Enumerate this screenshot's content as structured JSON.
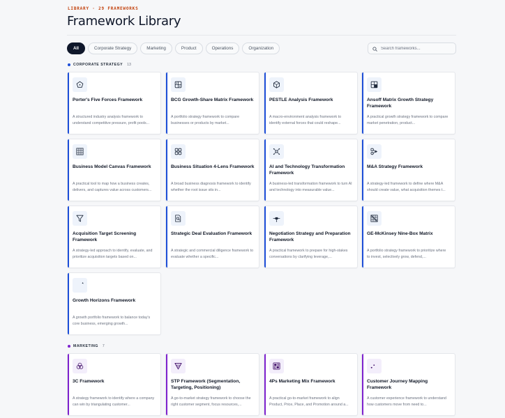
{
  "header": {
    "eyebrow": "LIBRARY · 29 FRAMEWORKS",
    "title": "Framework Library"
  },
  "filters": [
    "All",
    "Corporate Strategy",
    "Marketing",
    "Product",
    "Operations",
    "Organization"
  ],
  "active_filter": "All",
  "search": {
    "placeholder": "Search frameworks..."
  },
  "colors": {
    "eyebrow": "#c2410c",
    "corporate_accent": "#1d4ed8",
    "corporate_icon_bg": "#eef3fb",
    "marketing_accent": "#7e22ce",
    "marketing_icon_bg": "#f3eefb"
  },
  "sections": [
    {
      "name": "CORPORATE STRATEGY",
      "count": "13",
      "cards": [
        {
          "icon": "pentagon-icon",
          "title": "Porter's Five Forces Framework",
          "desc": "A structured industry analysis framework to understand competitive pressure, profit pools..."
        },
        {
          "icon": "grid-2x2-icon",
          "title": "BCG Growth-Share Matrix Framework",
          "desc": "A portfolio strategy framework to compare businesses or products by market..."
        },
        {
          "icon": "cube-icon",
          "title": "PESTLE Analysis Framework",
          "desc": "A macro-environment analysis framework to identify external forces that could reshape..."
        },
        {
          "icon": "matrix-arrow-icon",
          "title": "Ansoff Matrix Growth Strategy Framework",
          "desc": "A practical growth strategy framework to compare market penetration, product..."
        },
        {
          "icon": "canvas-grid-icon",
          "title": "Business Model Canvas Framework",
          "desc": "A practical tool to map how a business creates, delivers, and captures value across customers..."
        },
        {
          "icon": "four-lens-icon",
          "title": "Business Situation 4-Lens Framework",
          "desc": "A broad business diagnosis framework to identify whether the root issue sits in..."
        },
        {
          "icon": "ai-network-icon",
          "title": "AI and Technology Transformation Framework",
          "desc": "A business-led transformation framework to turn AI and technology into measurable value..."
        },
        {
          "icon": "merge-icon",
          "title": "M&A Strategy Framework",
          "desc": "A strategy-led framework to define where M&A should create value, what acquisition themes t..."
        },
        {
          "icon": "funnel-icon",
          "title": "Acquisition Target Screening Framework",
          "desc": "A strategy-led approach to identify, evaluate, and prioritize acquisition targets based on..."
        },
        {
          "icon": "document-search-icon",
          "title": "Strategic Deal Evaluation Framework",
          "desc": "A strategic and commercial diligence framework to evaluate whether a specific..."
        },
        {
          "icon": "negotiation-icon",
          "title": "Negotiation Strategy and Preparation Framework",
          "desc": "A practical framework to prepare for high-stakes conversations by clarifying leverage,..."
        },
        {
          "icon": "nine-box-icon",
          "title": "GE-McKinsey Nine-Box Matrix",
          "desc": "A portfolio strategy framework to prioritize where to invest, selectively grow, defend,..."
        },
        {
          "icon": "growth-curve-icon",
          "title": "Growth Horizons Framework",
          "desc": "A growth portfolio framework to balance today's core business, emerging growth..."
        }
      ]
    },
    {
      "name": "MARKETING",
      "count": "7",
      "cards": [
        {
          "icon": "three-circles-icon",
          "title": "3C Framework",
          "desc": "A strategy framework to identify where a company can win by triangulating customer..."
        },
        {
          "icon": "stp-funnel-icon",
          "title": "STP Framework (Segmentation, Targeting, Positioning)",
          "desc": "A go-to-market strategy framework to choose the right customer segment, focus resources,..."
        },
        {
          "icon": "four-ps-icon",
          "title": "4Ps Marketing Mix Framework",
          "desc": "A practical go-to-market framework to align Product, Price, Place, and Promotion around a..."
        },
        {
          "icon": "journey-path-icon",
          "title": "Customer Journey Mapping Framework",
          "desc": "A customer experience framework to understand how customers move from need to..."
        }
      ]
    }
  ]
}
